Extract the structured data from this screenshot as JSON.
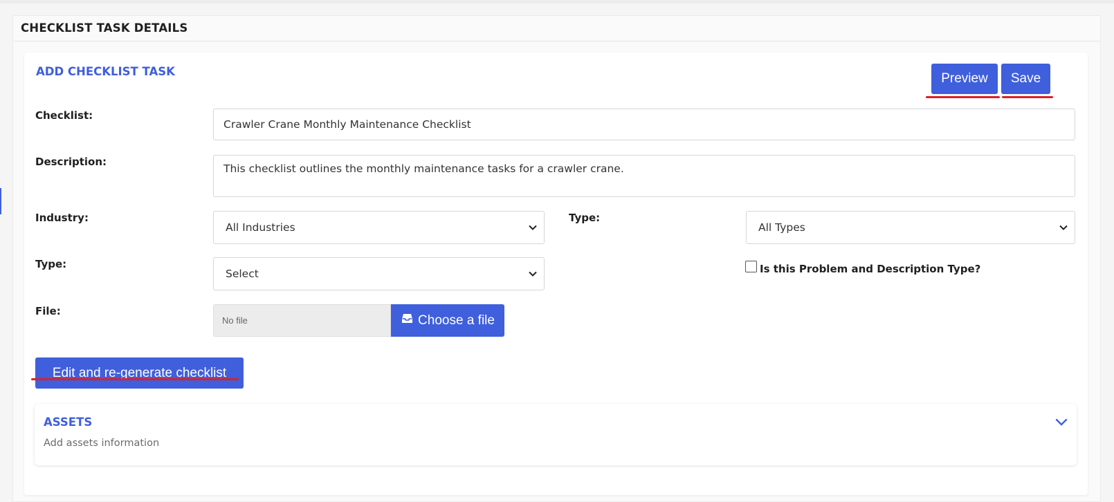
{
  "page": {
    "section_title": "CHECKLIST TASK DETAILS",
    "card_title": "ADD CHECKLIST TASK"
  },
  "actions": {
    "preview_label": "Preview",
    "save_label": "Save",
    "regenerate_label": "Edit and re-generate checklist",
    "choose_file_label": "Choose a file"
  },
  "form": {
    "checklist_label": "Checklist:",
    "checklist_value": "Crawler Crane Monthly Maintenance Checklist",
    "description_label": "Description:",
    "description_value": "This checklist outlines the monthly maintenance tasks for a crawler crane.",
    "industry_label": "Industry:",
    "industry_value": "All Industries",
    "type_right_label": "Type:",
    "type_right_value": "All Types",
    "type_left_label": "Type:",
    "type_left_value": "Select",
    "problem_checkbox_label": "Is this Problem and Description Type?",
    "problem_checkbox_checked": false,
    "file_label": "File:",
    "file_value": "No file"
  },
  "assets": {
    "title": "ASSETS",
    "subtitle": "Add assets information"
  },
  "icons": {
    "file_button_icon": "inbox-icon",
    "assets_toggle_icon": "chevron-down-icon",
    "select_caret_icon": "chevron-down-icon"
  },
  "colors": {
    "accent": "#3f5fdc",
    "annotation_underline": "#dd1f26"
  }
}
